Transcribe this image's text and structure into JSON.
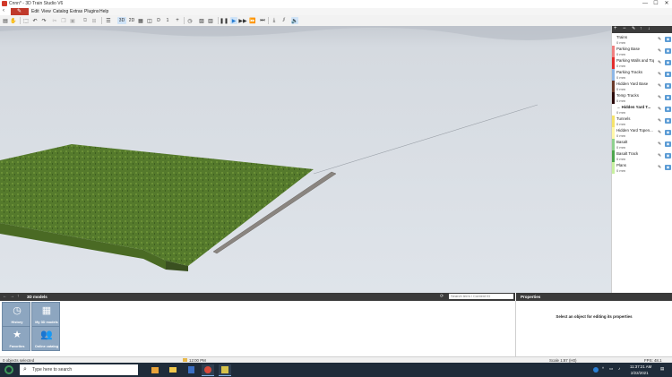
{
  "window": {
    "title": "Cnnn* - 3D Train Studio V6",
    "controls": [
      "—",
      "☐",
      "✕"
    ]
  },
  "menu": {
    "items": [
      "Edit",
      "View",
      "Catalog",
      "Extras",
      "Plugins",
      "Help"
    ],
    "accent": "#c0392b"
  },
  "toolbar": {
    "view_3d": "3D",
    "view_2d": "2D",
    "zoom_value": "1",
    "step_label": "D"
  },
  "layers": {
    "items": [
      {
        "name": "Trains",
        "size": "0 mm",
        "color": "#ffffff"
      },
      {
        "name": "Parking Base",
        "size": "0 mm",
        "color": "#f08080"
      },
      {
        "name": "Parking Walls and Top",
        "size": "0 mm",
        "color": "#e22d2d"
      },
      {
        "name": "Parking Tracks",
        "size": "0 mm",
        "color": "#8eb7e6"
      },
      {
        "name": "Hidden Yard Base",
        "size": "0 mm",
        "color": "#6b3a2a"
      },
      {
        "name": "Temp Tracks",
        "size": "0 mm",
        "color": "#2b0a0a"
      },
      {
        "name": "→ Hidden Yard T...",
        "size": "0 mm",
        "color": "#ffffff",
        "selected": true
      },
      {
        "name": "Tunnels",
        "size": "0 mm",
        "color": "#f5e36b"
      },
      {
        "name": "Hidden Yard Topen...",
        "size": "0 mm",
        "color": "#fff7a8"
      },
      {
        "name": "Basalt",
        "size": "0 mm",
        "color": "#8fd18f"
      },
      {
        "name": "Basalt Track",
        "size": "0 mm",
        "color": "#4da64d"
      },
      {
        "name": "Plans",
        "size": "0 mm",
        "color": "#c8f0a0"
      }
    ]
  },
  "library": {
    "title": "3D models",
    "search_placeholder": "Search term / Content ID",
    "tiles": [
      {
        "label": "History",
        "icon": "clock-icon"
      },
      {
        "label": "My 3D models",
        "icon": "grid-icon"
      },
      {
        "label": "Favorites",
        "icon": "star-icon"
      },
      {
        "label": "Online catalog",
        "icon": "people-icon"
      }
    ]
  },
  "properties": {
    "title": "Properties",
    "message": "Select an object for editing its properties"
  },
  "status": {
    "selection": "0 objects selected",
    "time": "12:00 PM",
    "scale": "Scale 1:87 (H0)",
    "fps": "FPS: 48.1"
  },
  "taskbar": {
    "search_placeholder": "Type here to search",
    "clock_time": "11:37:21 AM",
    "clock_date": "2/22/2021"
  }
}
